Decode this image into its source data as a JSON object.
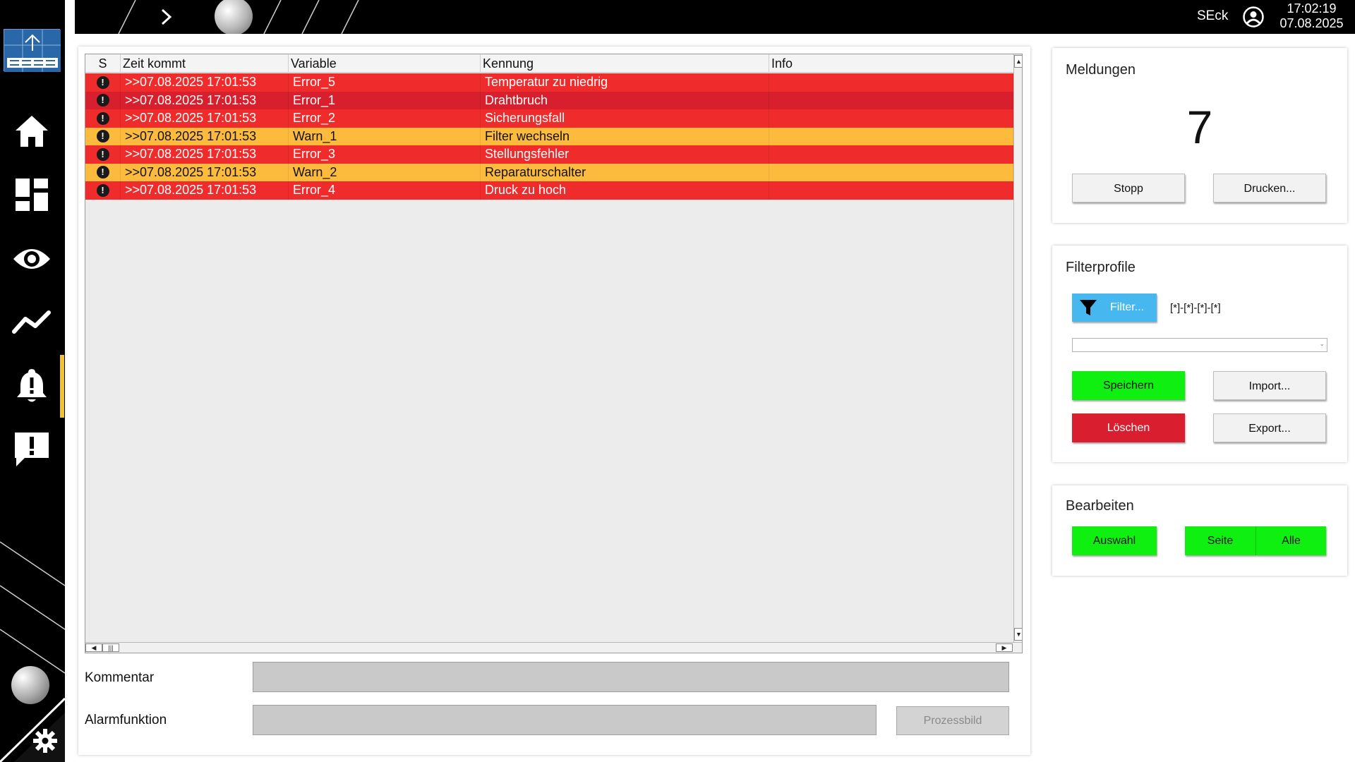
{
  "header": {
    "user": "SEck",
    "time": "17:02:19",
    "date": "07.08.2025"
  },
  "sidebar": {
    "items": [
      {
        "icon": "home-icon"
      },
      {
        "icon": "dashboard-icon"
      },
      {
        "icon": "eye-icon"
      },
      {
        "icon": "trend-icon"
      },
      {
        "icon": "bell-icon",
        "active": true
      },
      {
        "icon": "message-alert-icon"
      }
    ],
    "active_color": "#f2c230"
  },
  "table": {
    "columns": [
      "S",
      "Zeit kommt",
      "Variable",
      "Kennung",
      "Info"
    ],
    "rows": [
      {
        "time": ">>07.08.2025 17:01:53",
        "variable": "Error_5",
        "kennung": "Temperatur zu niedrig",
        "info": "",
        "color": "#ef2b2b"
      },
      {
        "time": ">>07.08.2025 17:01:53",
        "variable": "Error_1",
        "kennung": "Drahtbruch",
        "info": "",
        "color": "#d71f2e"
      },
      {
        "time": ">>07.08.2025 17:01:53",
        "variable": "Error_2",
        "kennung": "Sicherungsfall",
        "info": "",
        "color": "#ef2b2b"
      },
      {
        "time": ">>07.08.2025 17:01:53",
        "variable": "Warn_1",
        "kennung": "Filter wechseln",
        "info": "",
        "color": "#fdbb3e"
      },
      {
        "time": ">>07.08.2025 17:01:53",
        "variable": "Error_3",
        "kennung": "Stellungsfehler",
        "info": "",
        "color": "#ef2b2b"
      },
      {
        "time": ">>07.08.2025 17:01:53",
        "variable": "Warn_2",
        "kennung": "Reparaturschalter",
        "info": "",
        "color": "#fdbb3e"
      },
      {
        "time": ">>07.08.2025 17:01:53",
        "variable": "Error_4",
        "kennung": "Druck zu hoch",
        "info": "",
        "color": "#ef2b2b"
      }
    ],
    "severity_icon": "!"
  },
  "form": {
    "kommentar_label": "Kommentar",
    "kommentar_value": "",
    "alarmfunktion_label": "Alarmfunktion",
    "alarmfunktion_value": "",
    "prozessbild_label": "Prozessbild"
  },
  "meldungen": {
    "title": "Meldungen",
    "count": "7",
    "stop_label": "Stopp",
    "print_label": "Drucken..."
  },
  "filterprofile": {
    "title": "Filterprofile",
    "filter_label": "Filter...",
    "filter_expression": "[*]-[*]-[*]-[*]",
    "profile_selected": "",
    "save_label": "Speichern",
    "import_label": "Import...",
    "delete_label": "Löschen",
    "export_label": "Export..."
  },
  "bearbeiten": {
    "title": "Bearbeiten",
    "auswahl_label": "Auswahl",
    "seite_label": "Seite",
    "alle_label": "Alle"
  },
  "colors": {
    "error": "#ef2b2b",
    "error_dark": "#d71f2e",
    "warning": "#fdbb3e",
    "green_button": "#10f010",
    "red_button": "#d81e2f",
    "blue_button": "#46b8ef"
  }
}
